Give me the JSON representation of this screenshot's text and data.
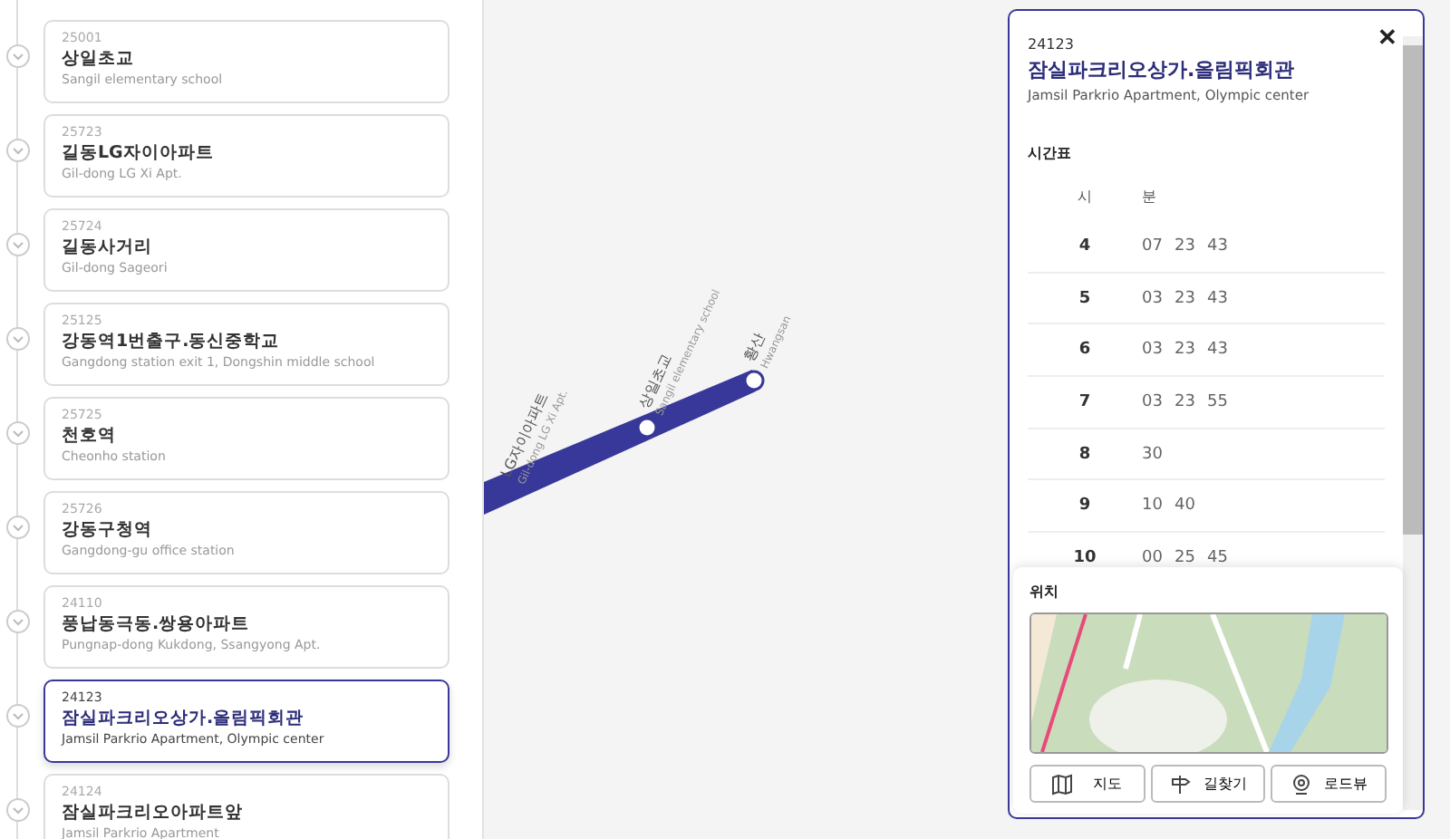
{
  "stops": [
    {
      "code": "25001",
      "name": "상일초교",
      "name_en": "Sangil elementary school",
      "selected": false
    },
    {
      "code": "25723",
      "name": "길동LG자이아파트",
      "name_en": "Gil-dong LG Xi Apt.",
      "selected": false
    },
    {
      "code": "25724",
      "name": "길동사거리",
      "name_en": "Gil-dong Sageori",
      "selected": false
    },
    {
      "code": "25125",
      "name": "강동역1번출구.동신중학교",
      "name_en": "Gangdong station exit 1, Dongshin middle school",
      "selected": false
    },
    {
      "code": "25725",
      "name": "천호역",
      "name_en": "Cheonho station",
      "selected": false
    },
    {
      "code": "25726",
      "name": "강동구청역",
      "name_en": "Gangdong-gu office station",
      "selected": false
    },
    {
      "code": "24110",
      "name": "풍납동극동.쌍용아파트",
      "name_en": "Pungnap-dong Kukdong, Ssangyong Apt.",
      "selected": false
    },
    {
      "code": "24123",
      "name": "잠실파크리오상가.올림픽회관",
      "name_en": "Jamsil Parkrio Apartment, Olympic center",
      "selected": true
    },
    {
      "code": "24124",
      "name": "잠실파크리오아파트앞",
      "name_en": "Jamsil Parkrio Apartment",
      "selected": false
    }
  ],
  "route_map": {
    "labels": [
      {
        "name": "LG자이아파트",
        "name_en": "Gil-dong LG Xi Apt."
      },
      {
        "name": "상일초교",
        "name_en": "Sangil elementary school"
      },
      {
        "name": "황산",
        "name_en": "Hwangsan"
      }
    ]
  },
  "detail": {
    "code": "24123",
    "name": "잠실파크리오상가.올림픽회관",
    "name_en": "Jamsil Parkrio Apartment, Olympic center",
    "close": "✕",
    "timetable_title": "시간표",
    "hour_header": "시",
    "minute_header": "분",
    "rows": [
      {
        "hour": "4",
        "minutes": [
          "07",
          "23",
          "43"
        ]
      },
      {
        "hour": "5",
        "minutes": [
          "03",
          "23",
          "43"
        ]
      },
      {
        "hour": "6",
        "minutes": [
          "03",
          "23",
          "43"
        ]
      },
      {
        "hour": "7",
        "minutes": [
          "03",
          "23",
          "55"
        ]
      },
      {
        "hour": "8",
        "minutes": [
          "30"
        ]
      },
      {
        "hour": "9",
        "minutes": [
          "10",
          "40"
        ]
      },
      {
        "hour": "10",
        "minutes": [
          "00",
          "25",
          "45"
        ]
      }
    ],
    "location_title": "위치",
    "buttons": [
      {
        "label": "지도",
        "kind": "map"
      },
      {
        "label": "길찾기",
        "kind": "directions"
      },
      {
        "label": "로드뷰",
        "kind": "roadview"
      }
    ]
  }
}
